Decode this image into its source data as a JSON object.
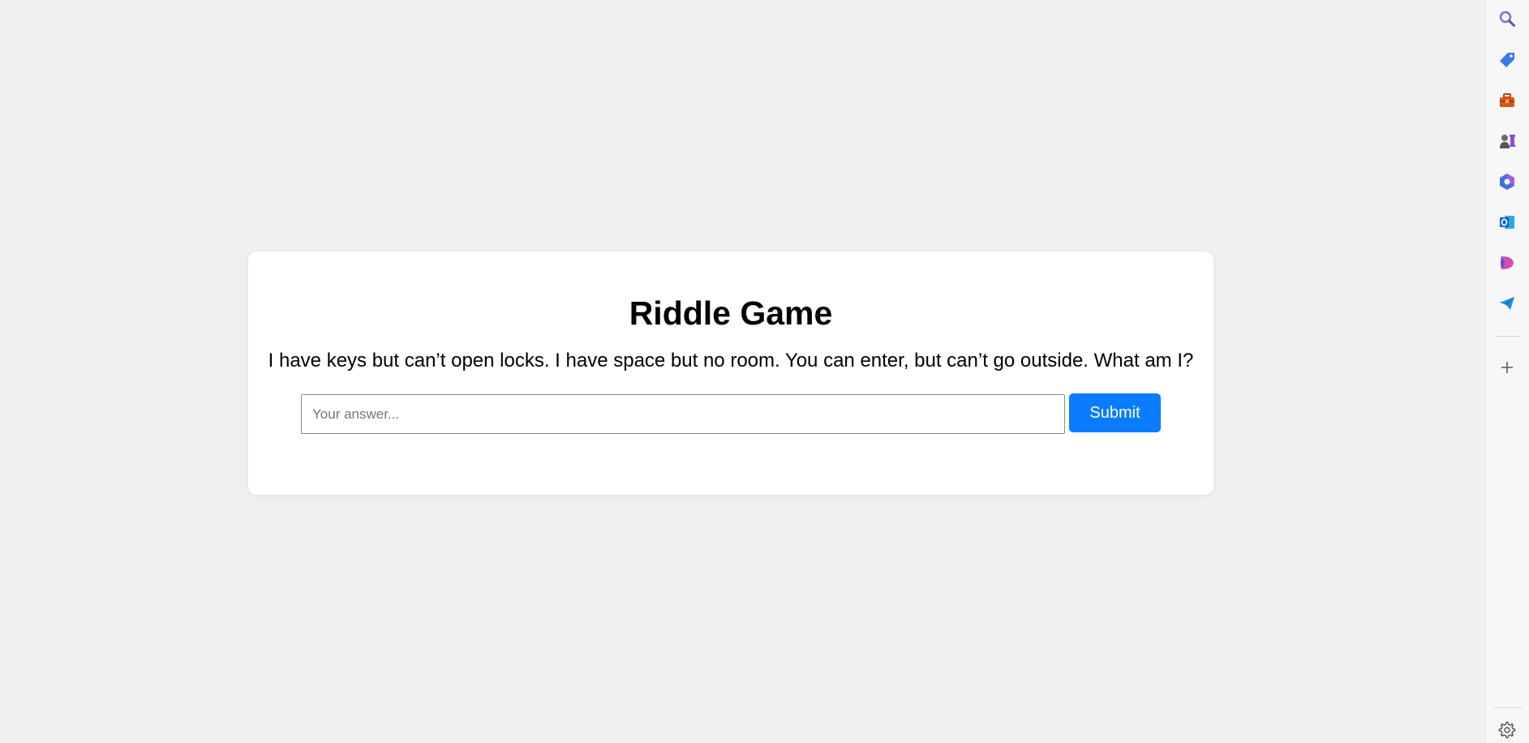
{
  "game": {
    "title": "Riddle Game",
    "riddle": "I have keys but can’t open locks. I have space but no room. You can enter, but can’t go outside. What am I?",
    "answer_value": "",
    "answer_placeholder": "Your answer...",
    "submit_label": "Submit"
  },
  "colors": {
    "background": "#f0f0f0",
    "card": "#ffffff",
    "accent": "#0a7cff"
  },
  "sidebar": {
    "icons": [
      "search-icon",
      "tag-icon",
      "toolbox-icon",
      "chess-icon",
      "copilot-icon",
      "outlook-icon",
      "designer-icon",
      "send-icon",
      "add-icon",
      "settings-icon"
    ]
  }
}
